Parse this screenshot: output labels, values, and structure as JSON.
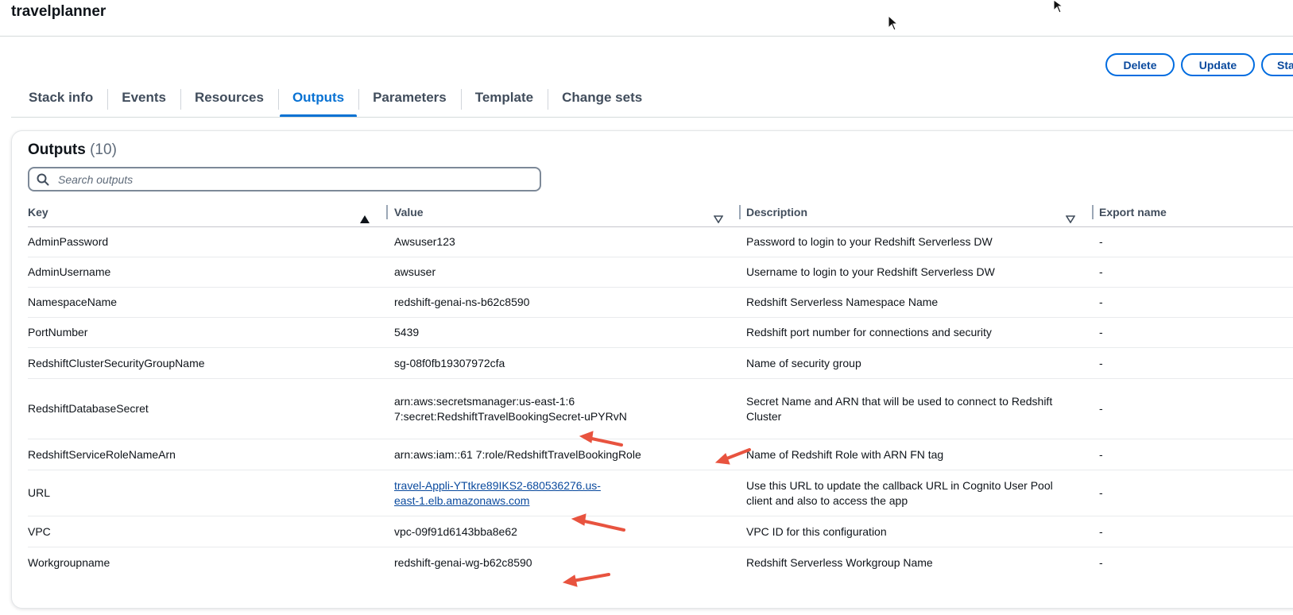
{
  "header": {
    "title": "travelplanner"
  },
  "actions": {
    "delete_label": "Delete",
    "update_label": "Update",
    "stack_label": "Sta"
  },
  "tabs": [
    {
      "label": "Stack info"
    },
    {
      "label": "Events"
    },
    {
      "label": "Resources"
    },
    {
      "label": "Outputs"
    },
    {
      "label": "Parameters"
    },
    {
      "label": "Template"
    },
    {
      "label": "Change sets"
    }
  ],
  "active_tab": "Outputs",
  "outputs": {
    "title": "Outputs",
    "count": "(10)",
    "search_placeholder": "Search outputs",
    "columns": {
      "key": "Key",
      "value": "Value",
      "description": "Description",
      "export": "Export name"
    },
    "rows": [
      {
        "key": "AdminPassword",
        "value": "Awsuser123",
        "description": "Password to login to your Redshift Serverless DW",
        "export": "-"
      },
      {
        "key": "AdminUsername",
        "value": "awsuser",
        "description": "Username to login to your Redshift Serverless DW",
        "export": "-"
      },
      {
        "key": "NamespaceName",
        "value": "redshift-genai-ns-b62c8590",
        "description": "Redshift Serverless Namespace Name",
        "export": "-"
      },
      {
        "key": "PortNumber",
        "value": "5439",
        "description": "Redshift port number for connections and security",
        "export": "-"
      },
      {
        "key": "RedshiftClusterSecurityGroupName",
        "value": "sg-08f0fb19307972cfa",
        "description": "Name of security group",
        "export": "-"
      },
      {
        "key": "RedshiftDatabaseSecret",
        "value": "arn:aws:secretsmanager:us-east-1:6          7:secret:RedshiftTravelBookingSecret-uPYRvN",
        "description": "Secret Name and ARN that will be used to connect to Redshift Cluster",
        "export": "-"
      },
      {
        "key": "RedshiftServiceRoleNameArn",
        "value": "arn:aws:iam::61          7:role/RedshiftTravelBookingRole",
        "description": "Name of Redshift Role with ARN FN tag",
        "export": "-"
      },
      {
        "key": "URL",
        "value": "travel-Appli-YTtkre89IKS2-680536276.us-east-1.elb.amazonaws.com",
        "description": "Use this URL to update the callback URL in Cognito User Pool client and also to access the app",
        "export": "-"
      },
      {
        "key": "VPC",
        "value": "vpc-09f91d6143bba8e62",
        "description": "VPC ID for this configuration",
        "export": "-"
      },
      {
        "key": "Workgroupname",
        "value": "redshift-genai-wg-b62c8590",
        "description": "Redshift Serverless Workgroup Name",
        "export": "-"
      }
    ]
  },
  "colors": {
    "accent": "#0972d3",
    "annotation_arrow": "#e8533f"
  }
}
